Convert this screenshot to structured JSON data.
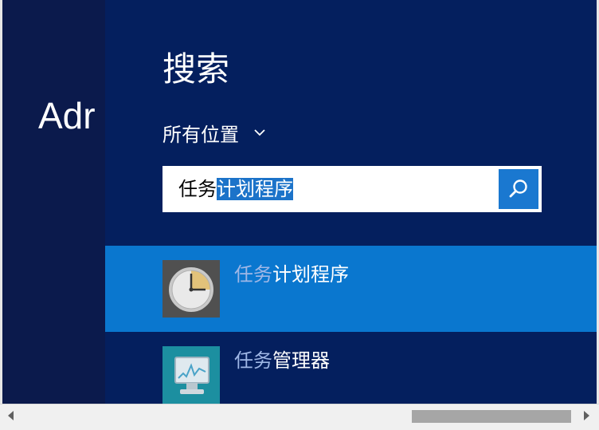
{
  "left": {
    "title": "Adr"
  },
  "search": {
    "heading": "搜索",
    "scope_label": "所有位置",
    "query_typed": "任务",
    "query_selected": "计划程序",
    "button_icon": "search-icon"
  },
  "results": [
    {
      "match": "任务",
      "rest": "计划程序",
      "icon": "clock-icon"
    },
    {
      "match": "任务",
      "rest": "管理器",
      "icon": "task-manager-icon"
    }
  ],
  "colors": {
    "panel_bg": "#041f5e",
    "selected_bg": "#0a77cf",
    "search_button": "#1a78d0"
  }
}
